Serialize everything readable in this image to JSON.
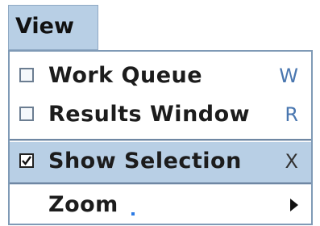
{
  "menu": {
    "title": "View",
    "items": [
      {
        "label": "Work Queue",
        "shortcut": "W",
        "checked": false
      },
      {
        "label": "Results Window",
        "shortcut": "R",
        "checked": false
      },
      {
        "label": "Show Selection",
        "shortcut": "X",
        "checked": true,
        "highlighted": true
      },
      {
        "label": "Zoom",
        "submenu": true
      }
    ]
  },
  "colors": {
    "highlight": "#b8cfe5",
    "border": "#7f9ab6",
    "shortcut": "#4a77b0"
  }
}
